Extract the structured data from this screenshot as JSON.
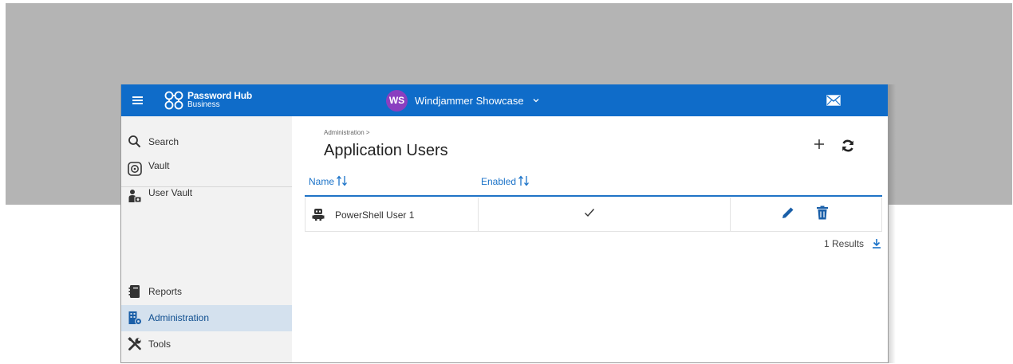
{
  "app": {
    "brand_title": "Password Hub",
    "brand_subtitle": "Business",
    "org_initials": "WS",
    "org_name": "Windjammer Showcase",
    "colors": {
      "header": "#0f6cc9",
      "avatar": "#8a3fc0",
      "active_nav": "#d4e1ee",
      "link": "#1a72c8"
    }
  },
  "sidebar": {
    "items": [
      {
        "label": "Search",
        "icon": "search-icon"
      },
      {
        "label": "Vault",
        "icon": "vault-icon"
      },
      {
        "label": "User Vault",
        "icon": "user-vault-icon"
      },
      {
        "label": "Reports",
        "icon": "reports-icon"
      },
      {
        "label": "Administration",
        "icon": "administration-icon",
        "active": true
      },
      {
        "label": "Tools",
        "icon": "tools-icon"
      }
    ]
  },
  "main": {
    "breadcrumb": "Administration >",
    "title": "Application Users",
    "columns": [
      "Name",
      "Enabled"
    ],
    "rows": [
      {
        "name": "PowerShell User 1",
        "enabled": true,
        "icon": "robot-icon"
      }
    ],
    "results": "1 Results"
  }
}
